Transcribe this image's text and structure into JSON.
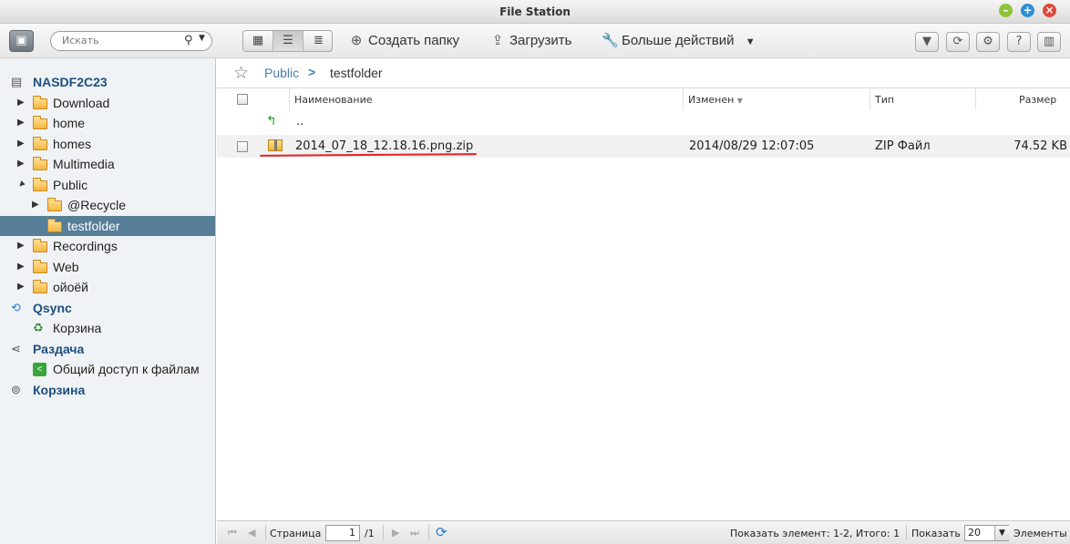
{
  "window": {
    "title": "File Station"
  },
  "toolbar": {
    "search_placeholder": "Искать",
    "create_folder": "Создать папку",
    "upload": "Загрузить",
    "more_actions": "Больше действий"
  },
  "sidebar": {
    "root": "NASDF2C23",
    "folders": [
      "Download",
      "home",
      "homes",
      "Multimedia",
      "Public"
    ],
    "public_children": [
      "@Recycle",
      "testfolder"
    ],
    "folders_after": [
      "Recordings",
      "Web",
      "ойоёй"
    ],
    "qsync": "Qsync",
    "qsync_trash": "Корзина",
    "share": "Раздача",
    "share_item": "Общий доступ к файлам",
    "trash": "Корзина"
  },
  "breadcrumb": {
    "parent": "Public",
    "separator": ">",
    "current": "testfolder"
  },
  "grid": {
    "columns": {
      "name": "Наименование",
      "modified": "Изменен",
      "type": "Тип",
      "size": "Размер"
    },
    "parent_row": "..",
    "rows": [
      {
        "name": "2014_07_18_12.18.16.png.zip",
        "modified": "2014/08/29 12:07:05",
        "type": "ZIP Файл",
        "size": "74.52 KB"
      }
    ]
  },
  "pager": {
    "page_label": "Страница",
    "page_value": "1",
    "page_total": "/1",
    "summary": "Показать элемент: 1-2, Итого: 1",
    "show_label": "Показать",
    "page_size": "20",
    "items_label": "Элементы"
  },
  "colors": {
    "accent": "#567e96",
    "link": "#4a7ea8",
    "underline": "#e52025"
  }
}
